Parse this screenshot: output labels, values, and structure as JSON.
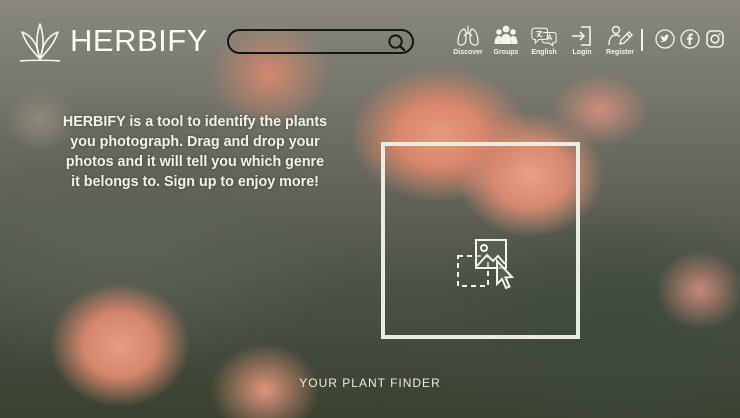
{
  "brand": {
    "name": "HERBIFY",
    "logo_icon": "leaf-icon"
  },
  "search": {
    "placeholder": "",
    "value": "",
    "icon": "search-icon"
  },
  "nav": [
    {
      "label": "Discover",
      "icon": "lungs-icon"
    },
    {
      "label": "Groups",
      "icon": "group-icon"
    },
    {
      "label": "English",
      "icon": "translate-icon"
    },
    {
      "label": "Login",
      "icon": "login-icon"
    },
    {
      "label": "Register",
      "icon": "register-icon"
    }
  ],
  "social": [
    {
      "name": "Twitter",
      "icon": "twitter-icon"
    },
    {
      "name": "Facebook",
      "icon": "facebook-icon"
    },
    {
      "name": "Instagram",
      "icon": "instagram-icon"
    }
  ],
  "intro": {
    "text": "HERBIFY is a tool to identify the plants you photograph. Drag and drop your photos and it will tell you which genre it belongs to. Sign up to enjoy more!"
  },
  "dropzone": {
    "icon": "image-drop-icon"
  },
  "footer": {
    "tagline": "YOUR PLANT FINDER"
  },
  "colors": {
    "text_light": "#f4f4ec",
    "search_border": "#151515",
    "dropzone_border": "#e9eee4"
  }
}
